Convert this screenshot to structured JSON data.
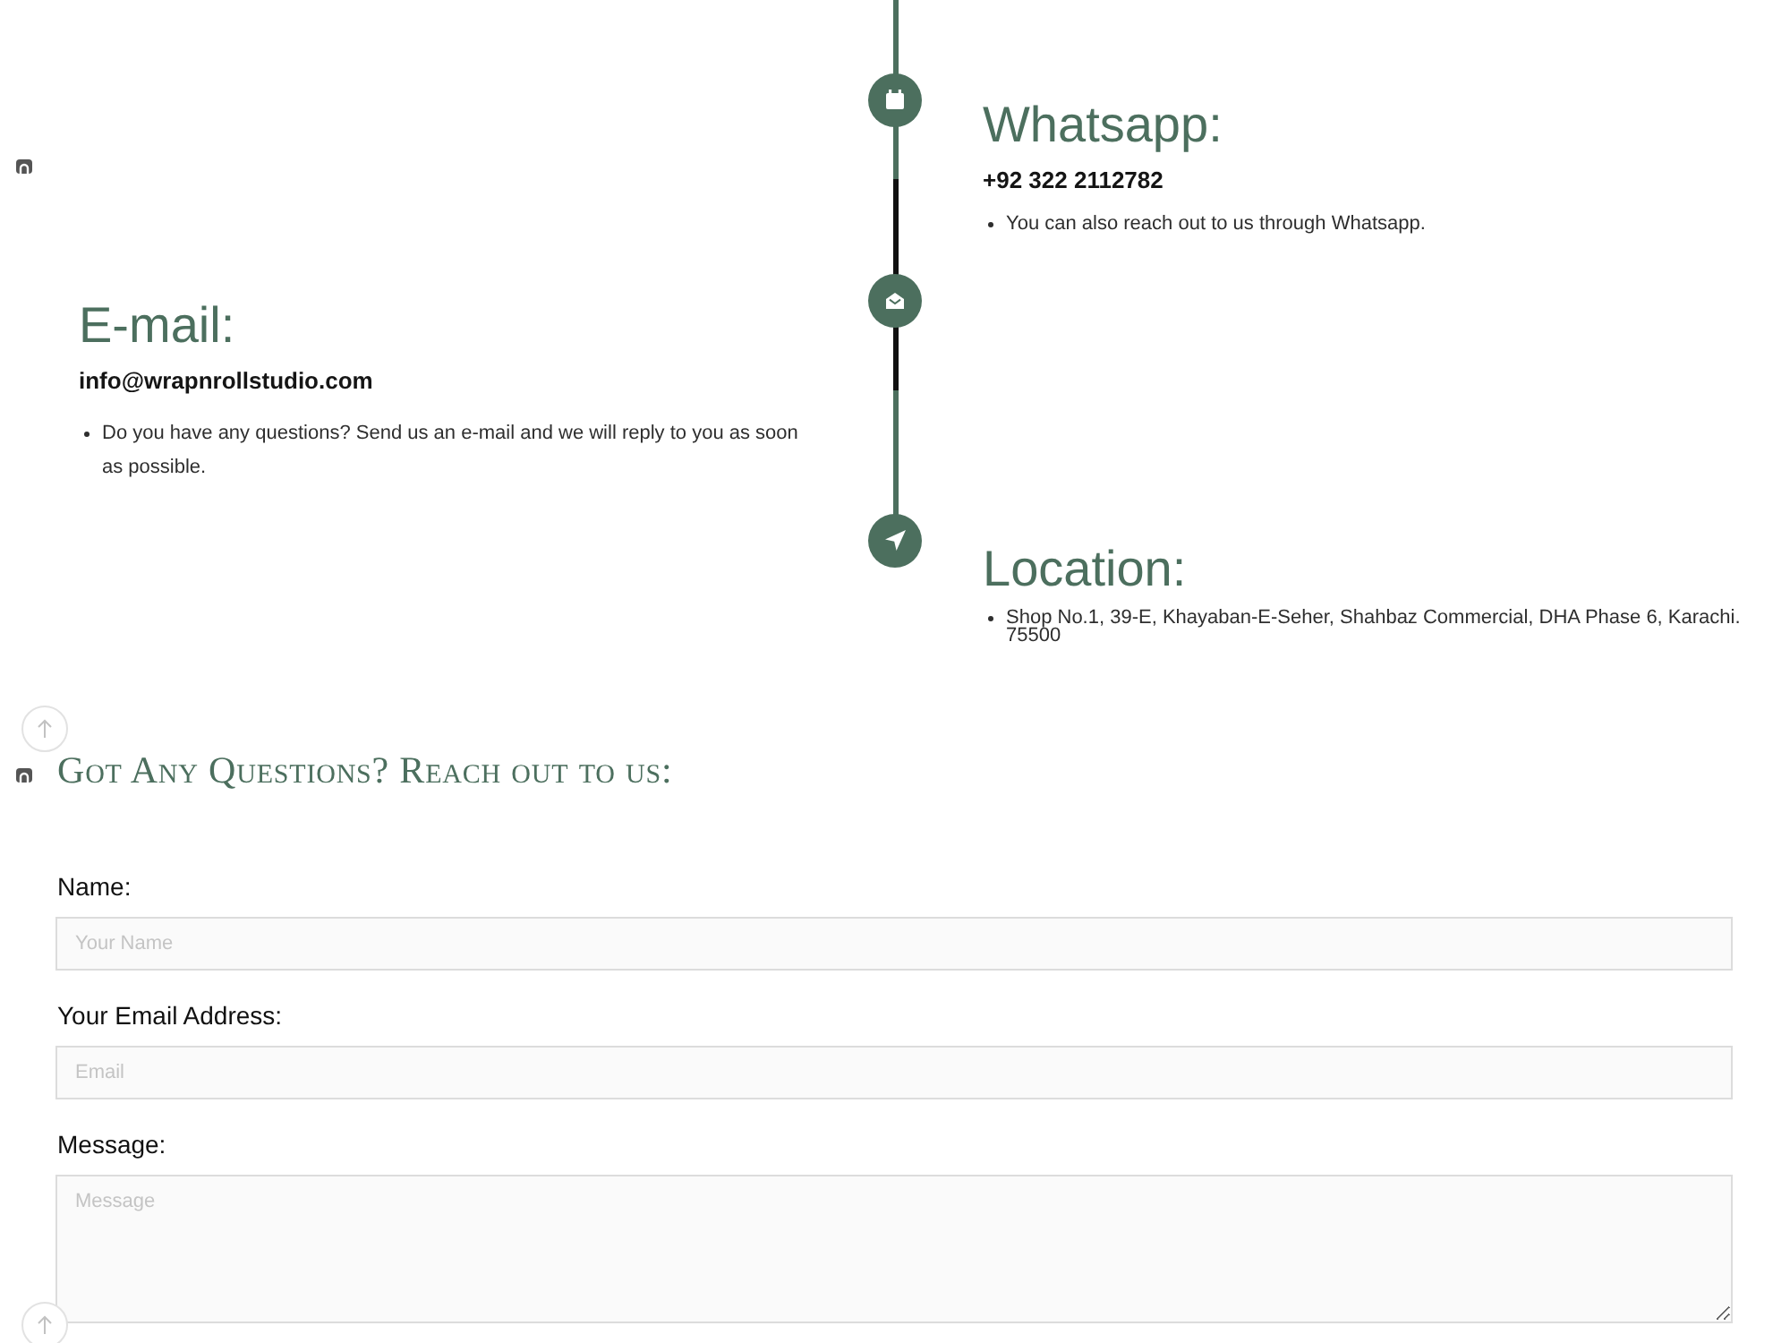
{
  "timeline": {
    "entries": [
      {
        "title": "Whatsapp:",
        "detail": "+92 322 2112782",
        "bullets": [
          "You can also reach out to us through Whatsapp."
        ]
      },
      {
        "title": "E-mail:",
        "detail": "info@wrapnrollstudio.com",
        "bullets": [
          "Do you have any questions? Send us an e-mail and we will reply to you as soon as possible."
        ]
      },
      {
        "title": "Location:",
        "bullets": [
          "Shop No.1, 39-E, Khayaban-E-Seher, Shahbaz Commercial, DHA Phase 6, Karachi. 75500"
        ]
      }
    ]
  },
  "contact_form": {
    "heading": "Got Any Questions? Reach out to us:",
    "fields": [
      {
        "kind": "input",
        "label": "Name:",
        "placeholder": "Your Name"
      },
      {
        "kind": "input",
        "label": "Your Email Address:",
        "placeholder": "Email"
      },
      {
        "kind": "textarea",
        "label": "Message:",
        "placeholder": "Message"
      }
    ]
  }
}
